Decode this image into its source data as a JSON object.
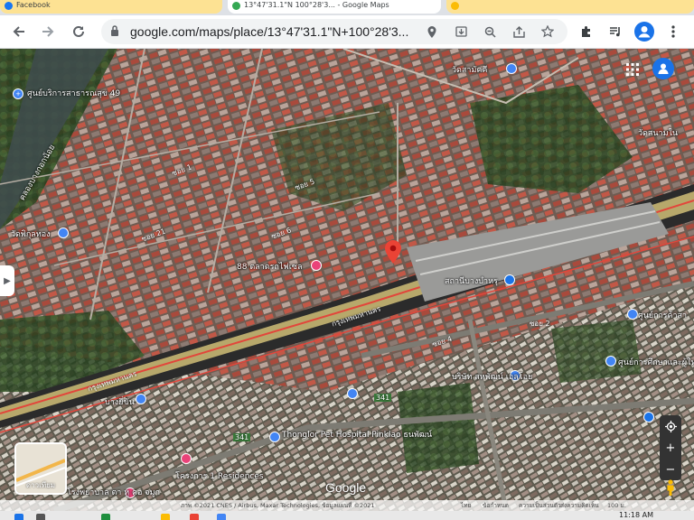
{
  "browser": {
    "tabs": [
      {
        "title": "Facebook",
        "active": false
      },
      {
        "title": "13°47'31.1\"N 100°28'3... - Google Maps",
        "active": true
      },
      {
        "title": "",
        "active": false
      }
    ],
    "url": "google.com/maps/place/13°47'31.1\"N+100°28'3...",
    "icons": [
      "back-icon",
      "forward-icon",
      "reload-icon",
      "lock-icon",
      "location-icon",
      "install-icon",
      "zoom-icon",
      "share-icon",
      "star-icon",
      "extensions-icon",
      "media-icon",
      "profile-icon",
      "menu-icon"
    ]
  },
  "map": {
    "labels": {
      "community_center": "ศูนย์บริการสาธารณสุข 49",
      "temple_top": "วัดสามัคคี",
      "temple_right": "วัดสนามใน",
      "temple_left": "วัดพิกุลทอง",
      "canal": "คลองบางกอกน้อย",
      "shop_88": "88 ตลาดรถไฟเซล",
      "station": "สถานีบางบำหรุ",
      "road_main": "กรุงเทพมหานคร",
      "road_main2": "กรุงเทพมหานคร",
      "bangyi": "บางยี่ขัน",
      "hospital": "Thonglor Pet Hospital Pinklao ธนพัฒน์",
      "residence": "โครงการ 1 Residences",
      "hospital2": "โรงพยาบาล ตา หู คอ จมูก",
      "school": "ศูนย์การศึกษาและผู้ใหญ่",
      "community_right": "ศูนย์การค้าสา",
      "right_shop": "บริษัท สหพัฒน์ เอลโอย",
      "soi_1": "ซอย 1",
      "soi_2": "ซอย 2",
      "soi_4": "ซอย 4",
      "soi_5": "ซอย 5",
      "soi_6": "ซอย 6",
      "soi_21": "ซอย 21",
      "road_341": "341",
      "road_341b": "341",
      "layers_label": "ดาวเทียม",
      "google": "Google"
    },
    "attribution": {
      "imagery": "ภาพ ©2021 CNES / Airbus, Maxar Technologies, ข้อมูลแผนที่ ©2021",
      "country": "ไทย",
      "terms": "ข้อกำหนด",
      "privacy": "ความเป็นส่วนตัว",
      "feedback": "ส่งความคิดเห็น",
      "scale": "100 ม."
    },
    "colors": {
      "pin": "#ea4335",
      "road_red": "#e2463b",
      "expressway": "#b7a86b",
      "accent": "#1a73e8"
    }
  },
  "taskbar": {
    "time": "11:18 AM",
    "date": ""
  }
}
